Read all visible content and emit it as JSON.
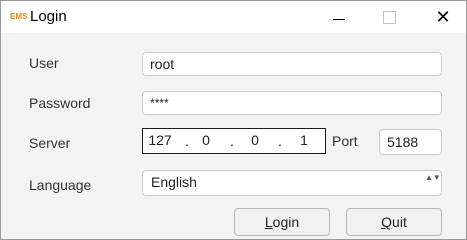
{
  "window": {
    "icon_text": "EMS",
    "title": "Login",
    "controls": {
      "minimize_icon": "minimize-icon",
      "maximize_icon": "maximize-icon",
      "close_icon": "close-icon",
      "close_glyph": "✕"
    }
  },
  "form": {
    "user_label": "User",
    "user_value": "root",
    "password_label": "Password",
    "password_value": "****",
    "server_label": "Server",
    "server_ip": [
      "127",
      "0",
      "0",
      "1"
    ],
    "ip_dot": ".",
    "port_label": "Port",
    "port_value": "5188",
    "language_label": "Language",
    "language_value": "English",
    "language_arrows": "▲▼"
  },
  "buttons": {
    "login_first": "L",
    "login_rest": "ogin",
    "quit_first": "Q",
    "quit_rest": "uit"
  },
  "colors": {
    "icon_orange": "#e8891b",
    "ip_border": "#1a1a1a",
    "input_border": "#c9c9c9"
  }
}
